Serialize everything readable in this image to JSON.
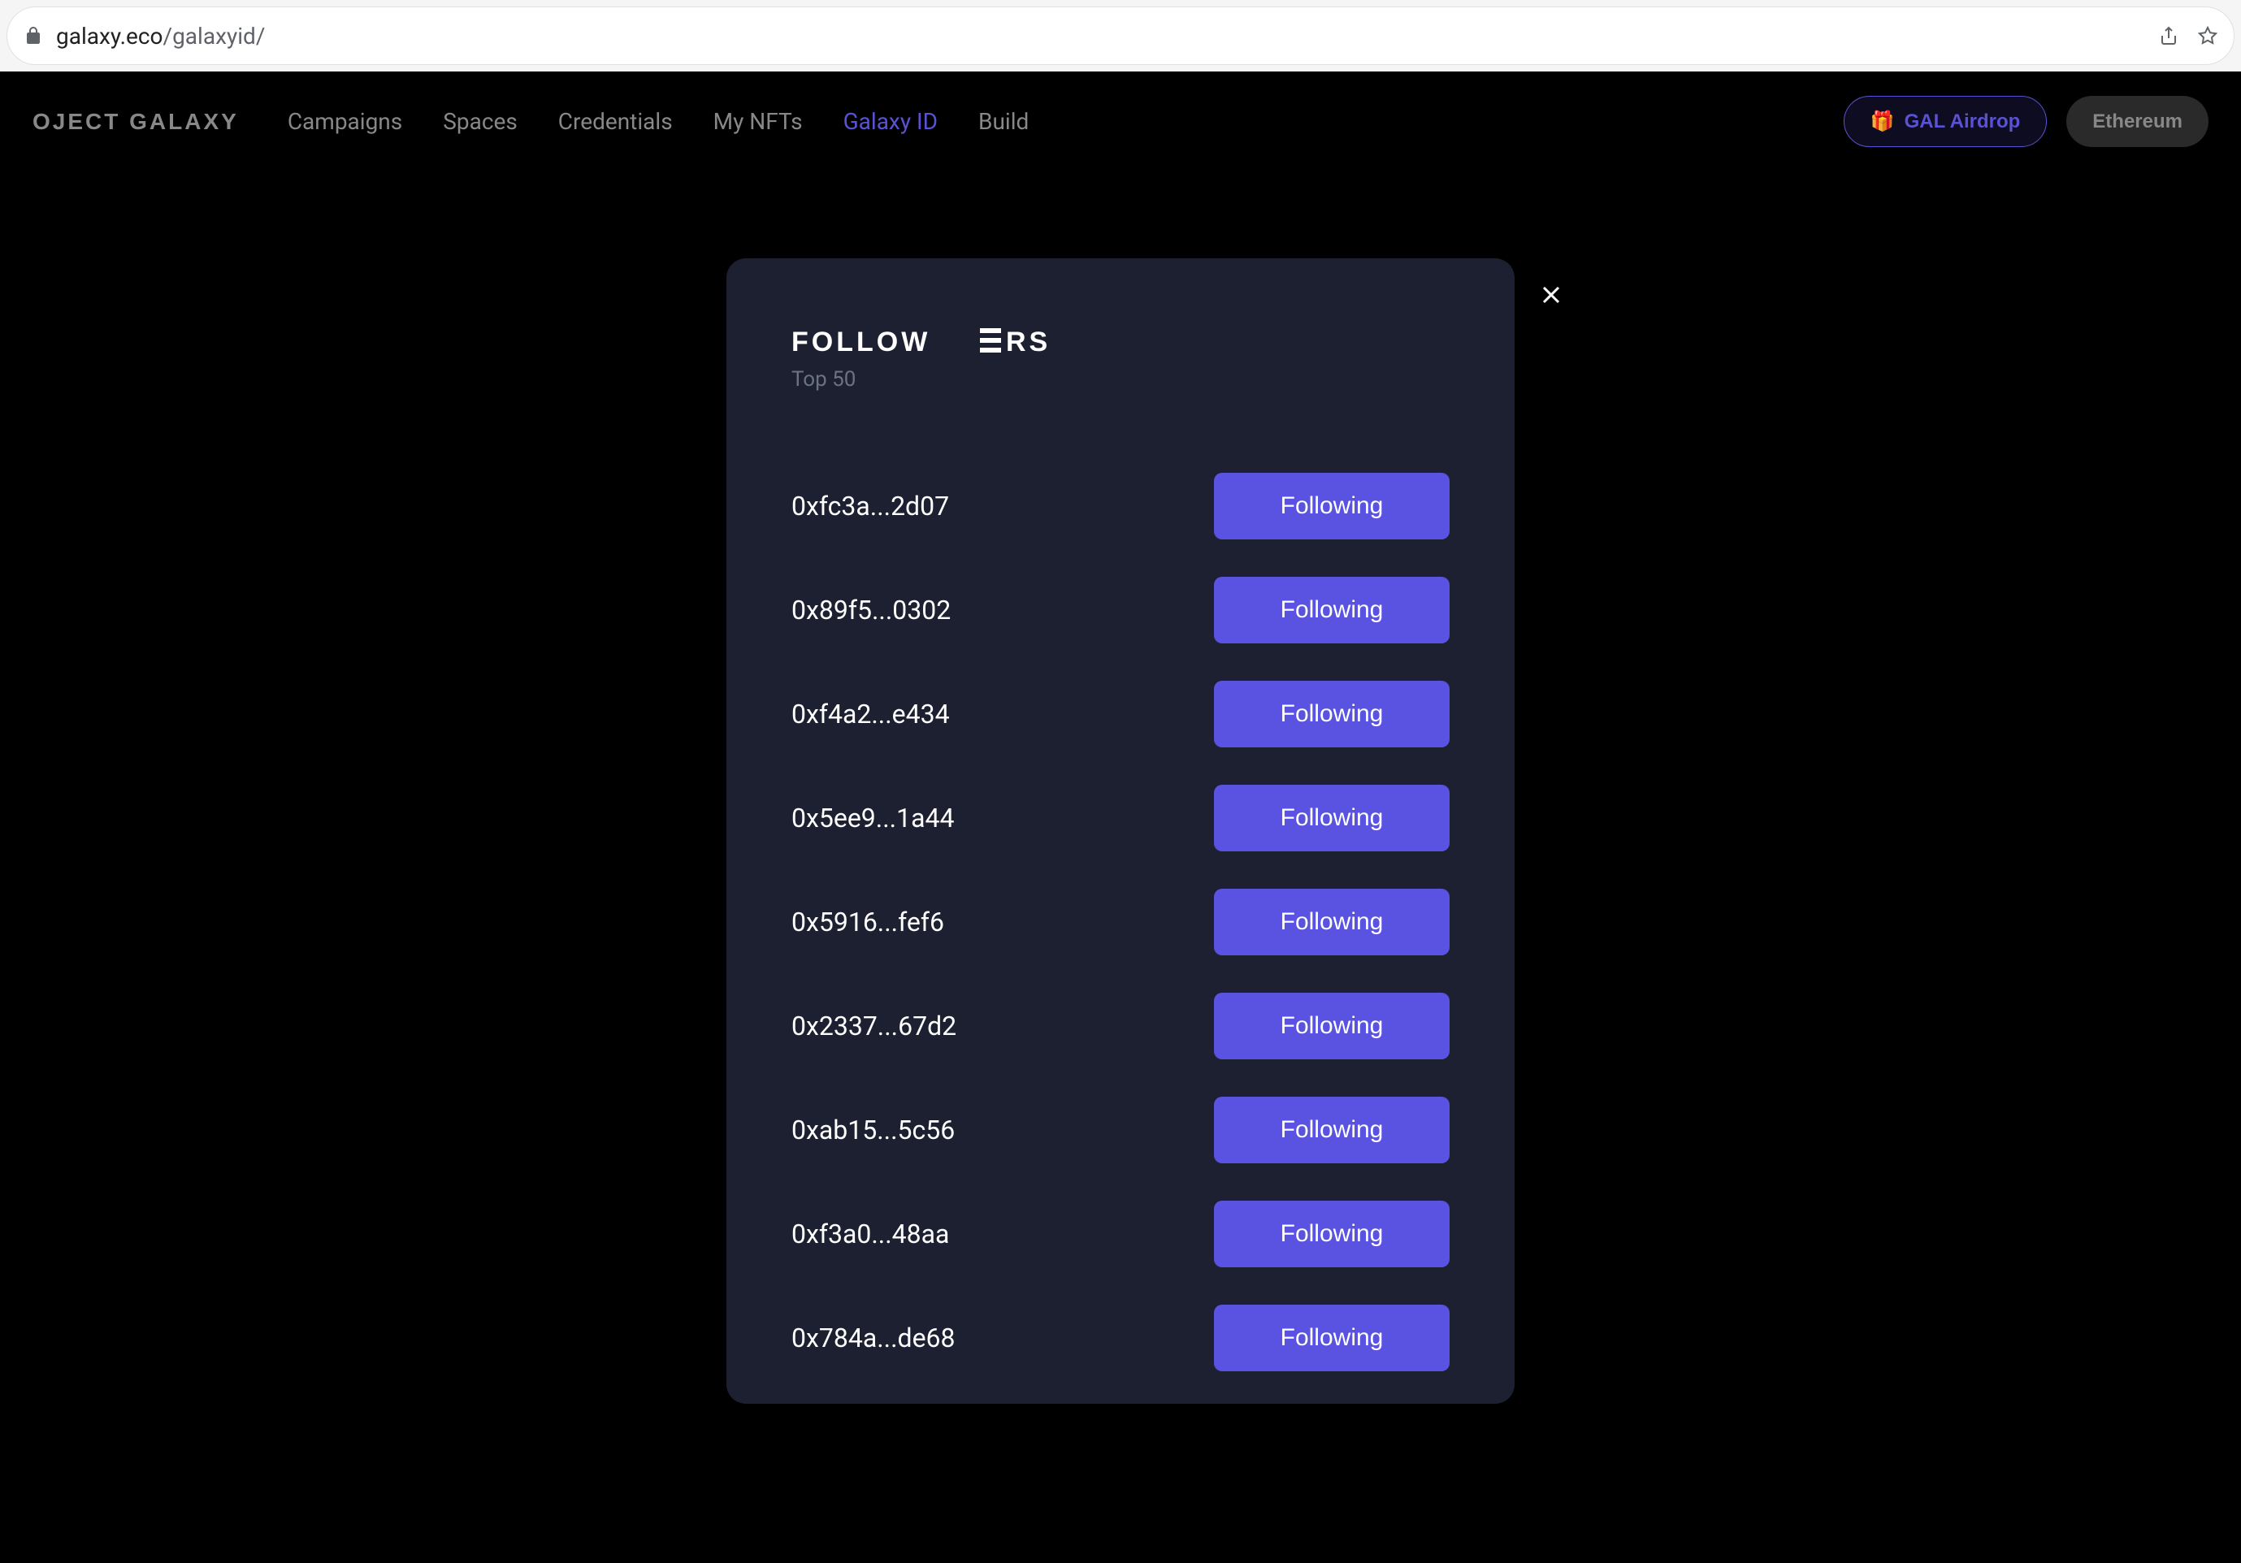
{
  "browser": {
    "url_domain": "galaxy.eco",
    "url_path": "/galaxyid/"
  },
  "header": {
    "logo": "OJECT GALAXY",
    "nav": [
      {
        "label": "Campaigns",
        "active": false
      },
      {
        "label": "Spaces",
        "active": false
      },
      {
        "label": "Credentials",
        "active": false
      },
      {
        "label": "My NFTs",
        "active": false
      },
      {
        "label": "Galaxy ID",
        "active": true
      },
      {
        "label": "Build",
        "active": false
      }
    ],
    "airdrop_label": "GAL Airdrop",
    "ethereum_label": "Ethereum"
  },
  "modal": {
    "title": "FOLLOWERS",
    "subtitle": "Top 50",
    "followers": [
      {
        "address": "0xfc3a...2d07",
        "status": "Following"
      },
      {
        "address": "0x89f5...0302",
        "status": "Following"
      },
      {
        "address": "0xf4a2...e434",
        "status": "Following"
      },
      {
        "address": "0x5ee9...1a44",
        "status": "Following"
      },
      {
        "address": "0x5916...fef6",
        "status": "Following"
      },
      {
        "address": "0x2337...67d2",
        "status": "Following"
      },
      {
        "address": "0xab15...5c56",
        "status": "Following"
      },
      {
        "address": "0xf3a0...48aa",
        "status": "Following"
      },
      {
        "address": "0x784a...de68",
        "status": "Following"
      }
    ]
  }
}
